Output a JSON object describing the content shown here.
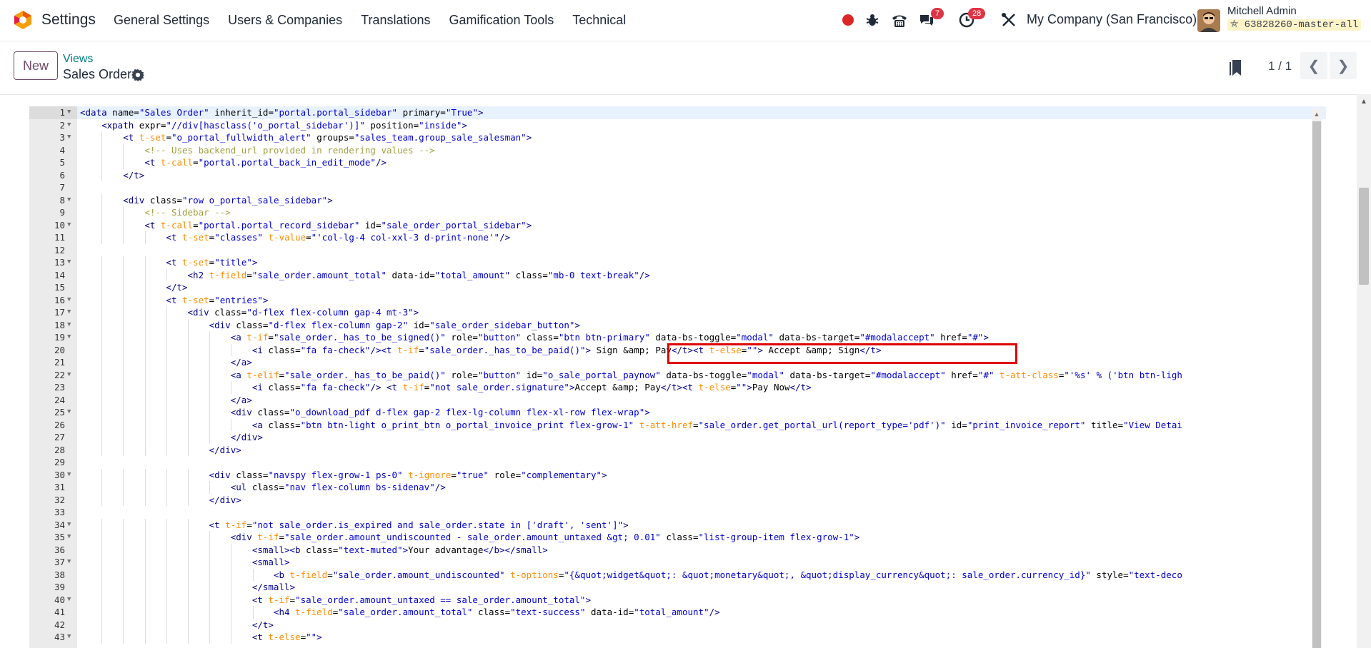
{
  "navbar": {
    "app_name": "Settings",
    "menu": [
      "General Settings",
      "Users & Companies",
      "Translations",
      "Gamification Tools",
      "Technical"
    ],
    "messages_count": "7",
    "activities_count": "28",
    "company": "My Company (San Francisco)",
    "user_name": "Mitchell Admin",
    "database": "63828260-master-all"
  },
  "control_panel": {
    "new_label": "New",
    "breadcrumb_parent": "Views",
    "breadcrumb_current": "Sales Order",
    "pager": "1 / 1"
  },
  "editor": {
    "active_line": 1,
    "highlighted_line": 20,
    "lines": [
      {
        "n": "1",
        "fold": true,
        "indent": 0,
        "code": "<data name=\"Sales Order\" inherit_id=\"portal.portal_sidebar\" primary=\"True\">"
      },
      {
        "n": "2",
        "fold": true,
        "indent": 1,
        "code": "<xpath expr=\"//div[hasclass('o_portal_sidebar')]\" position=\"inside\">"
      },
      {
        "n": "3",
        "fold": true,
        "indent": 2,
        "code": "<t t-set=\"o_portal_fullwidth_alert\" groups=\"sales_team.group_sale_salesman\">"
      },
      {
        "n": "4",
        "fold": false,
        "indent": 3,
        "code": "<!-- Uses backend_url provided in rendering values -->"
      },
      {
        "n": "5",
        "fold": false,
        "indent": 3,
        "code": "<t t-call=\"portal.portal_back_in_edit_mode\"/>"
      },
      {
        "n": "6",
        "fold": false,
        "indent": 2,
        "code": "</t>"
      },
      {
        "n": "7",
        "fold": false,
        "indent": 0,
        "code": ""
      },
      {
        "n": "8",
        "fold": true,
        "indent": 2,
        "code": "<div class=\"row o_portal_sale_sidebar\">"
      },
      {
        "n": "9",
        "fold": false,
        "indent": 3,
        "code": "<!-- Sidebar -->"
      },
      {
        "n": "10",
        "fold": true,
        "indent": 3,
        "code": "<t t-call=\"portal.portal_record_sidebar\" id=\"sale_order_portal_sidebar\">"
      },
      {
        "n": "11",
        "fold": false,
        "indent": 4,
        "code": "<t t-set=\"classes\" t-value=\"'col-lg-4 col-xxl-3 d-print-none'\"/>"
      },
      {
        "n": "12",
        "fold": false,
        "indent": 0,
        "code": ""
      },
      {
        "n": "13",
        "fold": true,
        "indent": 4,
        "code": "<t t-set=\"title\">"
      },
      {
        "n": "14",
        "fold": false,
        "indent": 5,
        "code": "<h2 t-field=\"sale_order.amount_total\" data-id=\"total_amount\" class=\"mb-0 text-break\"/>"
      },
      {
        "n": "15",
        "fold": false,
        "indent": 4,
        "code": "</t>"
      },
      {
        "n": "16",
        "fold": true,
        "indent": 4,
        "code": "<t t-set=\"entries\">"
      },
      {
        "n": "17",
        "fold": true,
        "indent": 5,
        "code": "<div class=\"d-flex flex-column gap-4 mt-3\">"
      },
      {
        "n": "18",
        "fold": true,
        "indent": 6,
        "code": "<div class=\"d-flex flex-column gap-2\" id=\"sale_order_sidebar_button\">"
      },
      {
        "n": "19",
        "fold": true,
        "indent": 7,
        "code": "<a t-if=\"sale_order._has_to_be_signed()\" role=\"button\" class=\"btn btn-primary\" data-bs-toggle=\"modal\" data-bs-target=\"#modalaccept\" href=\"#\">"
      },
      {
        "n": "20",
        "fold": false,
        "indent": 8,
        "code": "<i class=\"fa fa-check\"/><t t-if=\"sale_order._has_to_be_paid()\"> Sign &amp; Pay</t><t t-else=\"\"> Accept &amp; Sign</t>"
      },
      {
        "n": "21",
        "fold": false,
        "indent": 7,
        "code": "</a>"
      },
      {
        "n": "22",
        "fold": true,
        "indent": 7,
        "code": "<a t-elif=\"sale_order._has_to_be_paid()\" role=\"button\" id=\"o_sale_portal_paynow\" data-bs-toggle=\"modal\" data-bs-target=\"#modalaccept\" href=\"#\" t-att-class=\"'%s' % ('btn btn-ligh"
      },
      {
        "n": "23",
        "fold": false,
        "indent": 8,
        "code": "<i class=\"fa fa-check\"/> <t t-if=\"not sale_order.signature\">Accept &amp; Pay</t><t t-else=\"\">Pay Now</t>"
      },
      {
        "n": "24",
        "fold": false,
        "indent": 7,
        "code": "</a>"
      },
      {
        "n": "25",
        "fold": true,
        "indent": 7,
        "code": "<div class=\"o_download_pdf d-flex gap-2 flex-lg-column flex-xl-row flex-wrap\">"
      },
      {
        "n": "26",
        "fold": false,
        "indent": 8,
        "code": "<a class=\"btn btn-light o_print_btn o_portal_invoice_print flex-grow-1\" t-att-href=\"sale_order.get_portal_url(report_type='pdf')\" id=\"print_invoice_report\" title=\"View Detai"
      },
      {
        "n": "27",
        "fold": false,
        "indent": 7,
        "code": "</div>"
      },
      {
        "n": "28",
        "fold": false,
        "indent": 6,
        "code": "</div>"
      },
      {
        "n": "29",
        "fold": false,
        "indent": 0,
        "code": ""
      },
      {
        "n": "30",
        "fold": true,
        "indent": 6,
        "code": "<div class=\"navspy flex-grow-1 ps-0\" t-ignore=\"true\" role=\"complementary\">"
      },
      {
        "n": "31",
        "fold": false,
        "indent": 7,
        "code": "<ul class=\"nav flex-column bs-sidenav\"/>"
      },
      {
        "n": "32",
        "fold": false,
        "indent": 6,
        "code": "</div>"
      },
      {
        "n": "33",
        "fold": false,
        "indent": 0,
        "code": ""
      },
      {
        "n": "34",
        "fold": true,
        "indent": 6,
        "code": "<t t-if=\"not sale_order.is_expired and sale_order.state in ['draft', 'sent']\">"
      },
      {
        "n": "35",
        "fold": true,
        "indent": 7,
        "code": "<div t-if=\"sale_order.amount_undiscounted - sale_order.amount_untaxed &gt; 0.01\" class=\"list-group-item flex-grow-1\">"
      },
      {
        "n": "36",
        "fold": false,
        "indent": 8,
        "code": "<small><b class=\"text-muted\">Your advantage</b></small>"
      },
      {
        "n": "37",
        "fold": true,
        "indent": 8,
        "code": "<small>"
      },
      {
        "n": "38",
        "fold": false,
        "indent": 9,
        "code": "<b t-field=\"sale_order.amount_undiscounted\" t-options=\"{&quot;widget&quot;: &quot;monetary&quot;, &quot;display_currency&quot;: sale_order.currency_id}\" style=\"text-deco"
      },
      {
        "n": "39",
        "fold": false,
        "indent": 8,
        "code": "</small>"
      },
      {
        "n": "40",
        "fold": true,
        "indent": 8,
        "code": "<t t-if=\"sale_order.amount_untaxed == sale_order.amount_total\">"
      },
      {
        "n": "41",
        "fold": false,
        "indent": 9,
        "code": "<h4 t-field=\"sale_order.amount_total\" class=\"text-success\" data-id=\"total_amount\"/>"
      },
      {
        "n": "42",
        "fold": false,
        "indent": 8,
        "code": "</t>"
      },
      {
        "n": "43",
        "fold": true,
        "indent": 8,
        "code": "<t t-else=\"\">"
      }
    ]
  },
  "colors": {
    "brand": "#714B67",
    "link": "#017e84",
    "badge": "#dc3545",
    "highlight_box": "#e00000"
  }
}
